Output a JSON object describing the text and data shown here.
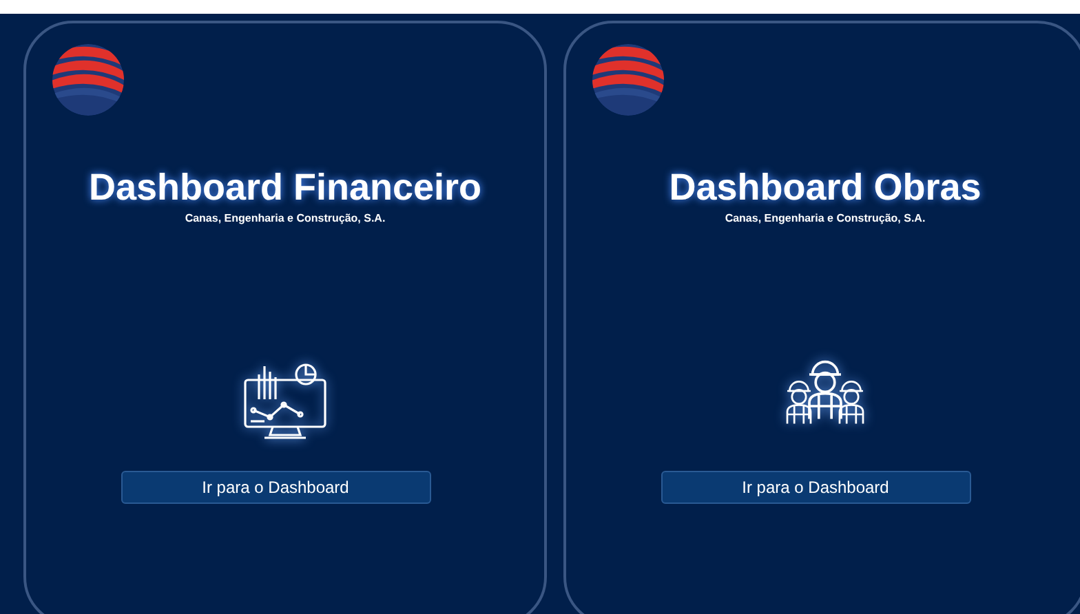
{
  "cards": [
    {
      "title": "Dashboard Financeiro",
      "subtitle": "Canas, Engenharia e Construção, S.A.",
      "kind": "chart",
      "button": "Ir para o Dashboard"
    },
    {
      "title": "Dashboard Obras",
      "subtitle": "Canas, Engenharia e Construção, S.A.",
      "kind": "workers",
      "button": "Ir para o Dashboard"
    }
  ]
}
